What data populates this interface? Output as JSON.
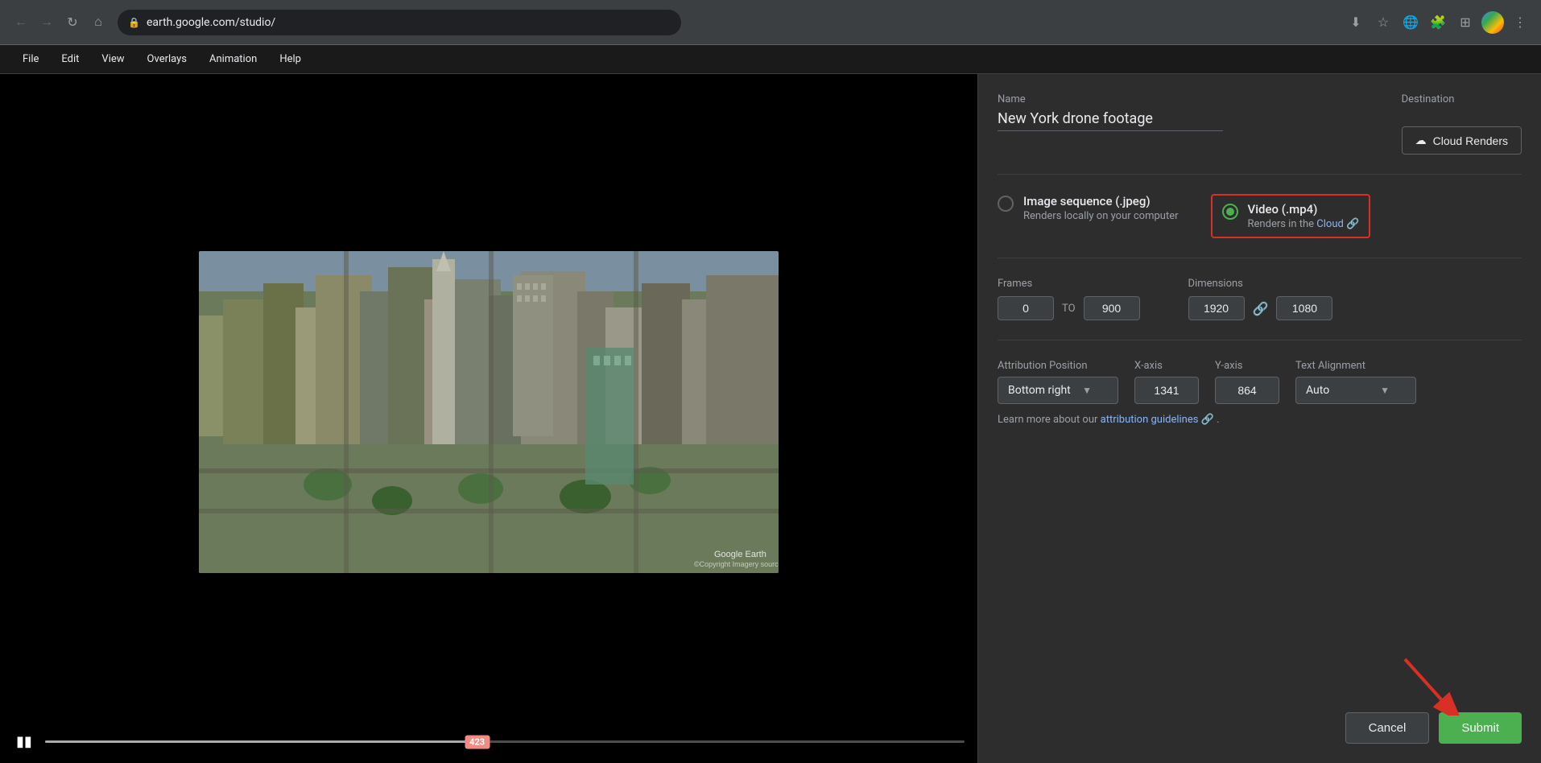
{
  "browser": {
    "back_disabled": true,
    "forward_disabled": true,
    "url": "earth.google.com/studio/",
    "security_icon": "🔒"
  },
  "app_menu": {
    "items": [
      "File",
      "Edit",
      "View",
      "Overlays",
      "Animation",
      "Help"
    ]
  },
  "settings": {
    "name_label": "Name",
    "name_value": "New York drone footage",
    "destination_label": "Destination",
    "destination_btn": "Cloud Renders",
    "format": {
      "image_sequence_label": "Image sequence (.jpeg)",
      "image_sequence_sublabel": "Renders locally on your computer",
      "video_label": "Video (.mp4)",
      "video_sublabel": "Renders in the",
      "video_cloud_link": "Cloud",
      "selected": "video"
    },
    "frames": {
      "label": "Frames",
      "from": "0",
      "to_label": "TO",
      "to": "900"
    },
    "dimensions": {
      "label": "Dimensions",
      "width": "1920",
      "height": "1080"
    },
    "attribution": {
      "position_label": "Attribution Position",
      "position_value": "Bottom right",
      "xaxis_label": "X-axis",
      "xaxis_value": "1341",
      "yaxis_label": "Y-axis",
      "yaxis_value": "864",
      "text_align_label": "Text Alignment",
      "text_align_value": "Auto",
      "note_prefix": "Learn more about our",
      "note_link": "attribution guidelines",
      "note_suffix": "."
    },
    "cancel_btn": "Cancel",
    "submit_btn": "Submit"
  },
  "video_player": {
    "frame_number": "423",
    "google_earth_label": "Google Earth",
    "copyright_label": "©Copyright Imagery sources"
  }
}
